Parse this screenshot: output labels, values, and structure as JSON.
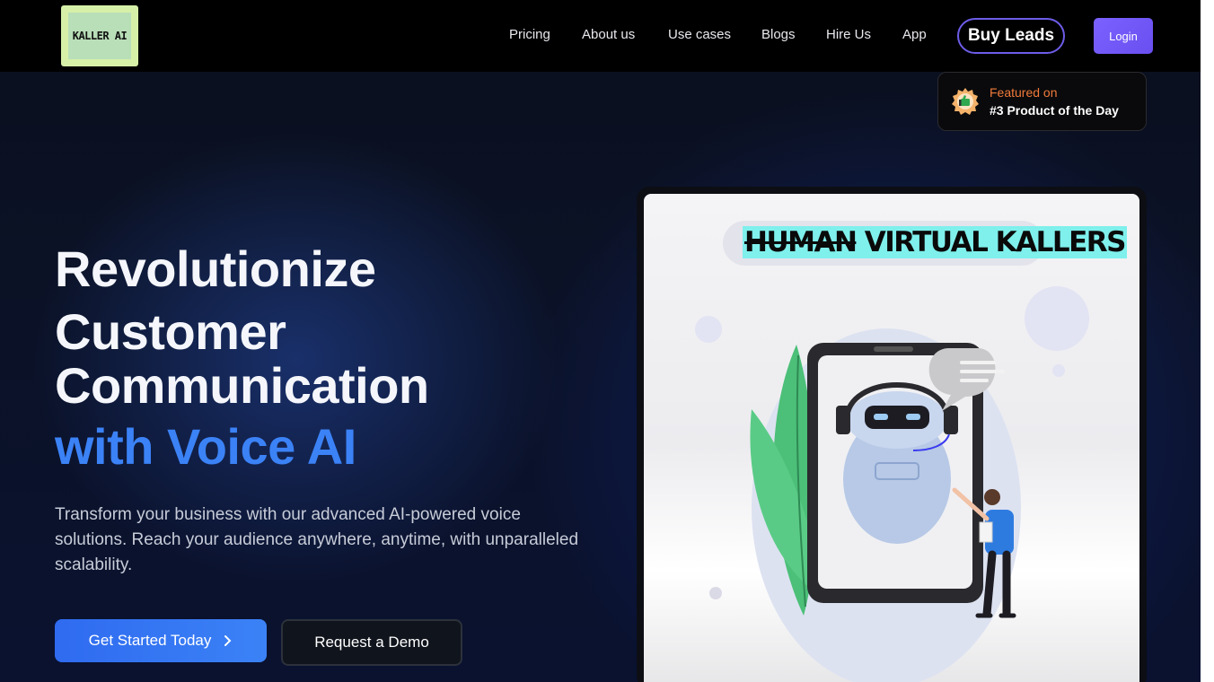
{
  "header": {
    "logo_text": "KALLER AI",
    "nav": [
      "Pricing",
      "About us",
      "Use cases",
      "Blogs",
      "Hire Us",
      "App"
    ],
    "buy_leads": "Buy Leads",
    "login": "Login"
  },
  "featured": {
    "line1": "Featured on",
    "line2": "#3 Product of the Day"
  },
  "hero": {
    "title_line1": "Revolutionize",
    "title_line2": "Customer",
    "title_line3": "Communication",
    "title_highlight": "with Voice AI",
    "subtitle": "Transform your business with our advanced AI-powered voice solutions. Reach your audience anywhere, anytime, with unparalleled scalability.",
    "cta_primary": "Get Started Today",
    "cta_primary_icon": "chevron-right-icon",
    "cta_secondary": "Request a Demo"
  },
  "card": {
    "strike_word": "HUMAN",
    "headline_rest": "VIRTUAL KALLERS"
  },
  "colors": {
    "accent_blue": "#3b82f6",
    "login_purple": "#7b61ff",
    "featured_orange": "#f07a3a",
    "highlight_cyan": "#7ff0ec"
  }
}
